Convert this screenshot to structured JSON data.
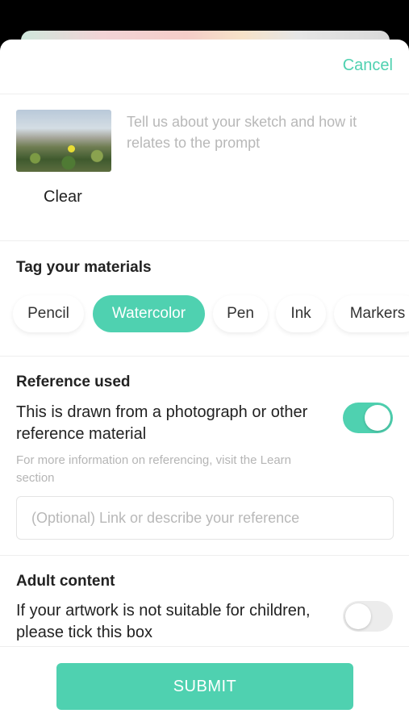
{
  "header": {
    "cancel_label": "Cancel"
  },
  "sketch": {
    "clear_label": "Clear",
    "description_placeholder": "Tell us about your sketch and how it relates to the prompt"
  },
  "materials": {
    "title": "Tag your materials",
    "chips": [
      {
        "label": "Pencil",
        "selected": false
      },
      {
        "label": "Watercolor",
        "selected": true
      },
      {
        "label": "Pen",
        "selected": false
      },
      {
        "label": "Ink",
        "selected": false
      },
      {
        "label": "Markers",
        "selected": false
      }
    ]
  },
  "reference": {
    "title": "Reference used",
    "toggle_text": "This is drawn from a photograph or other reference material",
    "toggle_on": true,
    "note": "For more information on referencing, visit the Learn section",
    "input_placeholder": "(Optional) Link or describe your reference"
  },
  "adult": {
    "title": "Adult content",
    "toggle_text": "If your artwork is not suitable for children, please tick this box",
    "toggle_on": false
  },
  "footer": {
    "submit_label": "SUBMIT"
  },
  "colors": {
    "accent": "#4fd1b0",
    "text": "#222222",
    "muted": "#b8b8b8"
  }
}
